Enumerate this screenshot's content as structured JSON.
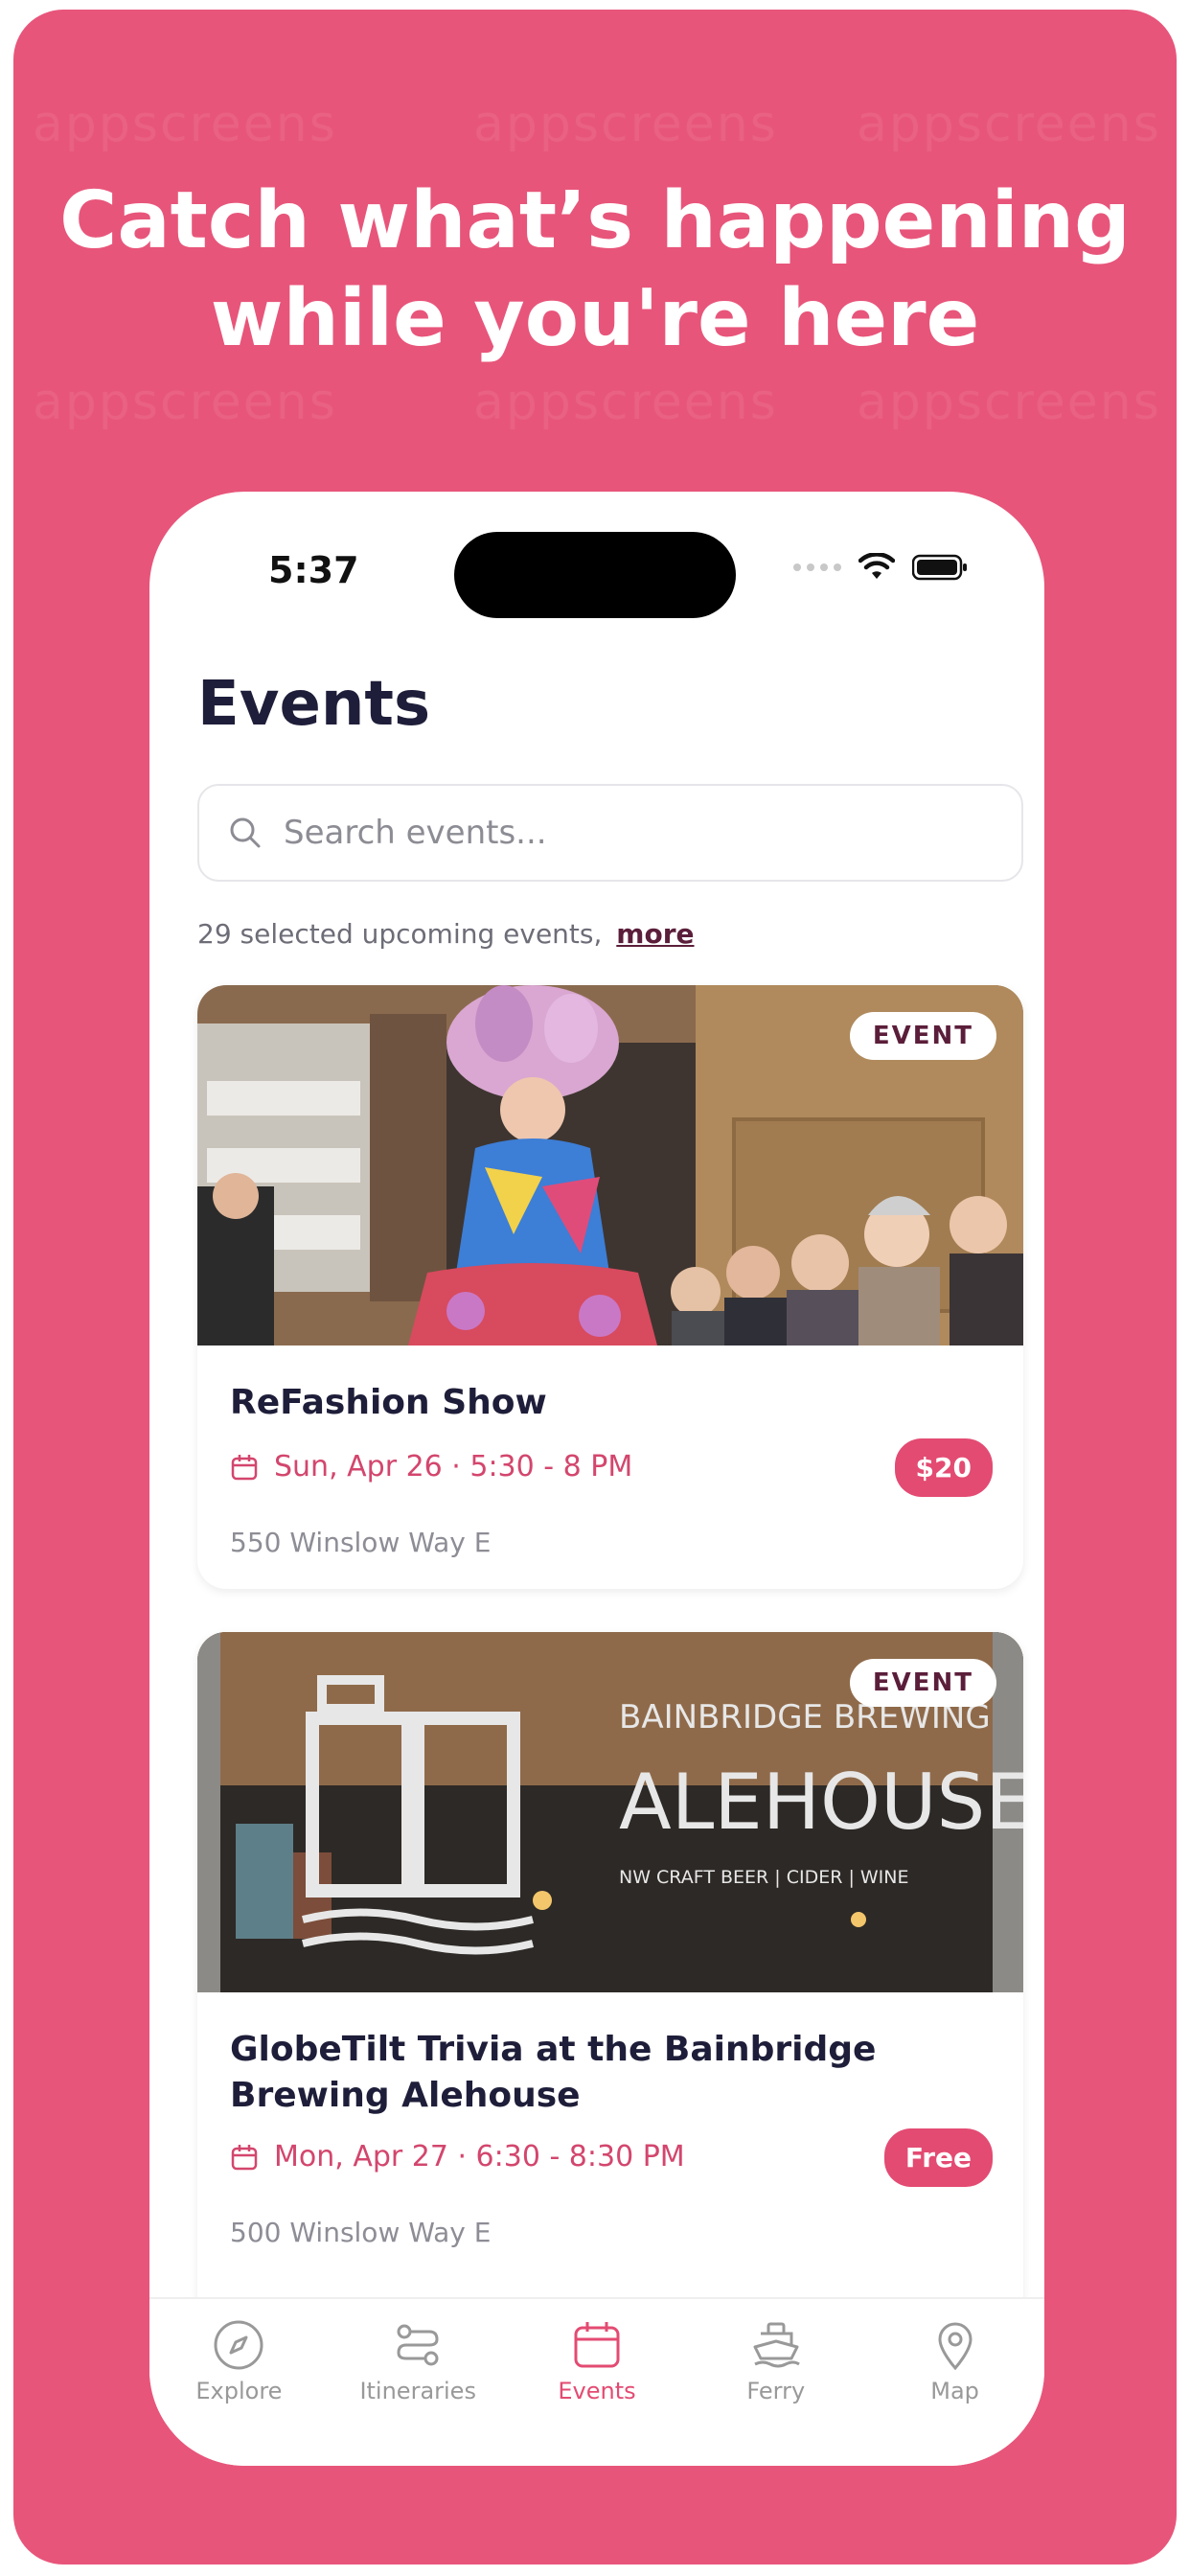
{
  "headline": {
    "line1": "Catch what’s happening",
    "line2": "while you're here"
  },
  "watermark": "appscreens",
  "status": {
    "time": "5:37"
  },
  "events_page": {
    "title": "Events",
    "search_placeholder": "Search events...",
    "count_text": "29 selected upcoming events,",
    "more_link": "more"
  },
  "events": [
    {
      "badge": "EVENT",
      "name": "ReFashion Show",
      "date": "Sun, Apr 26 · 5:30 - 8 PM",
      "price": "$20",
      "address": "550 Winslow Way E"
    },
    {
      "badge": "EVENT",
      "name": "GlobeTilt Trivia at the Bainbridge Brewing Alehouse",
      "date": "Mon, Apr 27 · 6:30 - 8:30 PM",
      "price": "Free",
      "address": "500 Winslow Way E",
      "sign": {
        "line1": "BAINBRIDGE BREWING",
        "line2": "ALEHOUSE",
        "line3": "NW CRAFT BEER | CIDER | WINE"
      }
    }
  ],
  "tabs": [
    {
      "label": "Explore",
      "icon": "compass-icon"
    },
    {
      "label": "Itineraries",
      "icon": "route-icon"
    },
    {
      "label": "Events",
      "icon": "calendar-icon",
      "active": true
    },
    {
      "label": "Ferry",
      "icon": "ferry-icon"
    },
    {
      "label": "Map",
      "icon": "map-pin-icon"
    }
  ],
  "colors": {
    "brand": "#e8557a",
    "accent": "#e34b72",
    "title": "#1e1e3a"
  }
}
